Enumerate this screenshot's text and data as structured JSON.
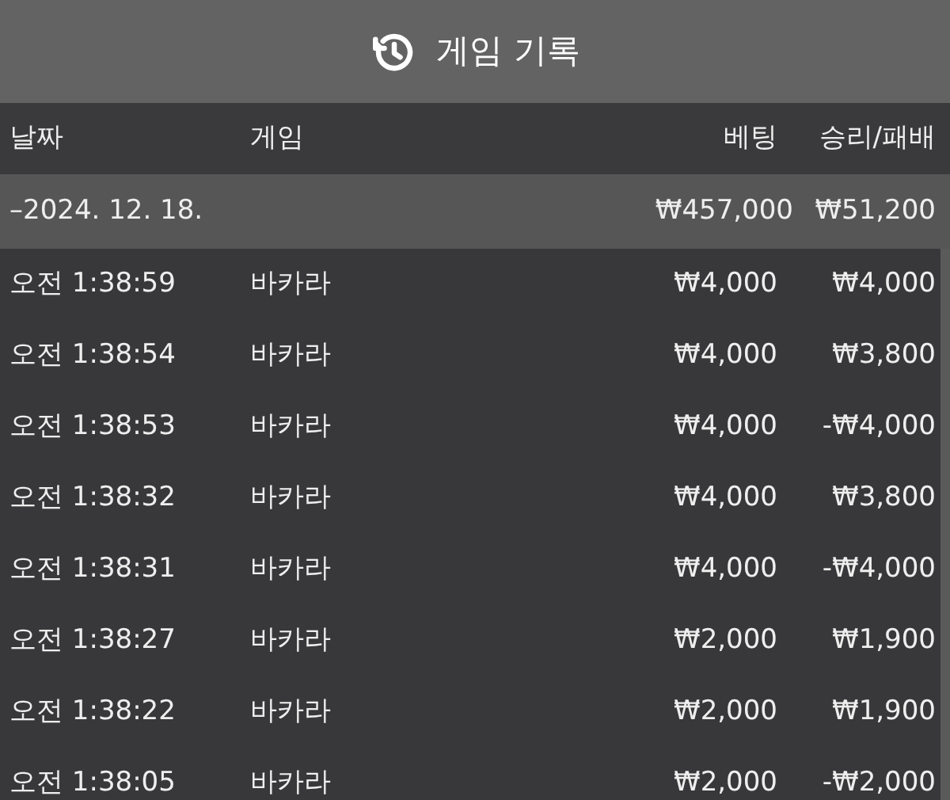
{
  "header": {
    "title": "게임 기록"
  },
  "table": {
    "columns": [
      "날짜",
      "게임",
      "베팅",
      "승리/패배"
    ],
    "group": {
      "date": "–2024. 12. 18.",
      "bet": "₩457,000",
      "result": "₩51,200"
    },
    "rows": [
      {
        "time": "오전 1:38:59",
        "game": "바카라",
        "bet": "₩4,000",
        "result": "₩4,000"
      },
      {
        "time": "오전 1:38:54",
        "game": "바카라",
        "bet": "₩4,000",
        "result": "₩3,800"
      },
      {
        "time": "오전 1:38:53",
        "game": "바카라",
        "bet": "₩4,000",
        "result": "-₩4,000"
      },
      {
        "time": "오전 1:38:32",
        "game": "바카라",
        "bet": "₩4,000",
        "result": "₩3,800"
      },
      {
        "time": "오전 1:38:31",
        "game": "바카라",
        "bet": "₩4,000",
        "result": "-₩4,000"
      },
      {
        "time": "오전 1:38:27",
        "game": "바카라",
        "bet": "₩2,000",
        "result": "₩1,900"
      },
      {
        "time": "오전 1:38:22",
        "game": "바카라",
        "bet": "₩2,000",
        "result": "₩1,900"
      },
      {
        "time": "오전 1:38:05",
        "game": "바카라",
        "bet": "₩2,000",
        "result": "-₩2,000"
      }
    ]
  }
}
